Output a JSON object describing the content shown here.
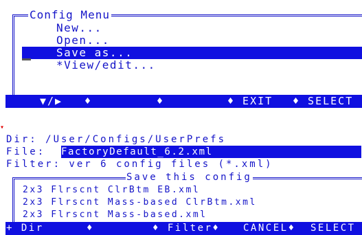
{
  "config_menu": {
    "title": "Config Menu",
    "items": [
      "New...",
      "Open...",
      "Save as...",
      "*View/edit..."
    ],
    "selected_index": 2,
    "bottom_bar": {
      "nav_keys": "▼/▶",
      "diamond": "♦",
      "exit": "♦ EXIT",
      "select": "♦ SELECT"
    }
  },
  "file_dialog": {
    "dir_line": "Dir: /User/Configs/UserPrefs",
    "file_label": "File:",
    "file_value": "FactoryDefault_6.2.xml",
    "filter_line": "Filter: ver 6 config files (*.xml)",
    "list_title": "Save this config",
    "files": [
      "2x3 Flrscnt ClrBtm EB.xml",
      "2x3 Flrscnt Mass-based ClrBtm.xml",
      "2x3 Flrscnt Mass-based.xml"
    ],
    "bottom_bar": {
      "plus_dir": "+ Dir",
      "diamond": "♦",
      "filter": "♦ Filter♦",
      "cancel": "CANCEL♦",
      "select": "SELECT"
    }
  }
}
